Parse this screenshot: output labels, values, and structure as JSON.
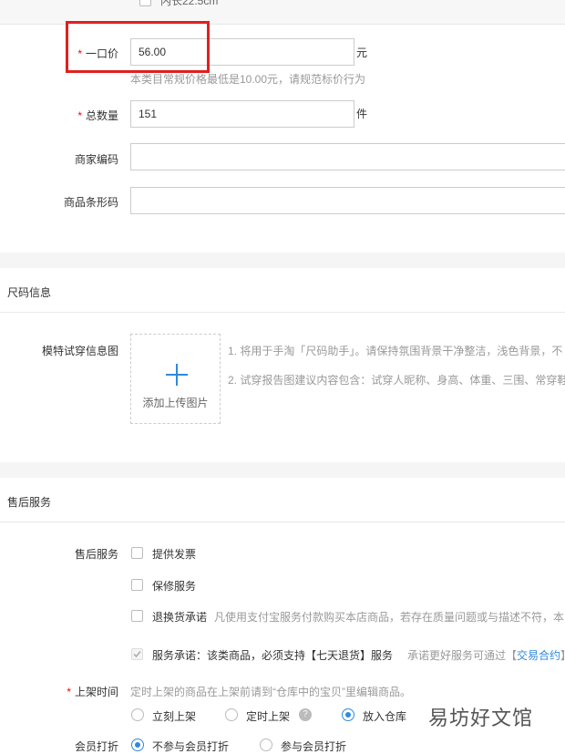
{
  "top_partial": {
    "checkbox_label": "内长22.5cm"
  },
  "price": {
    "label": "一口价",
    "required_mark": "*",
    "value": "56.00",
    "unit": "元",
    "hint": "本类目常规价格最低是10.00元，请规范标价行为"
  },
  "quantity": {
    "label": "总数量",
    "required_mark": "*",
    "value": "151",
    "unit": "件"
  },
  "merchant_code": {
    "label": "商家编码",
    "value": ""
  },
  "barcode": {
    "label": "商品条形码",
    "value": ""
  },
  "size_section": {
    "title": "尺码信息",
    "model_label": "模特试穿信息图",
    "upload_label": "添加上传图片",
    "tips": [
      "1. 将用于手淘「尺码助手」。请保持氛围背景干净整洁，浅色背景，不",
      "2. 试穿报告图建议内容包含：试穿人昵称、身高、体重、三围、常穿鞋"
    ]
  },
  "after_sales": {
    "title": "售后服务",
    "label": "售后服务",
    "options": [
      {
        "label": "提供发票",
        "checked": false
      },
      {
        "label": "保修服务",
        "checked": false
      },
      {
        "label": "退换货承诺",
        "checked": false,
        "desc": "凡使用支付宝服务付款购买本店商品，若存在质量问题或与描述不符，本"
      },
      {
        "label": "服务承诺：该类商品，必须支持【七天退货】服务",
        "checked": true,
        "disabled": true,
        "desc": "承诺更好服务可通过【",
        "link": "交易合约",
        "desc_end": "】"
      }
    ]
  },
  "listing_time": {
    "label": "上架时间",
    "required_mark": "*",
    "hint": "定时上架的商品在上架前请到“仓库中的宝贝”里编辑商品。",
    "options": [
      {
        "label": "立刻上架",
        "selected": false
      },
      {
        "label": "定时上架",
        "selected": false,
        "help": "?"
      },
      {
        "label": "放入仓库",
        "selected": true
      }
    ]
  },
  "member_discount": {
    "label": "会员打折",
    "options": [
      {
        "label": "不参与会员打折",
        "selected": true
      },
      {
        "label": "参与会员打折",
        "selected": false
      }
    ]
  },
  "watermark": "易坊好文馆",
  "colors": {
    "accent": "#3089dc",
    "required": "#ff0000",
    "highlight_box": "#e02020"
  }
}
